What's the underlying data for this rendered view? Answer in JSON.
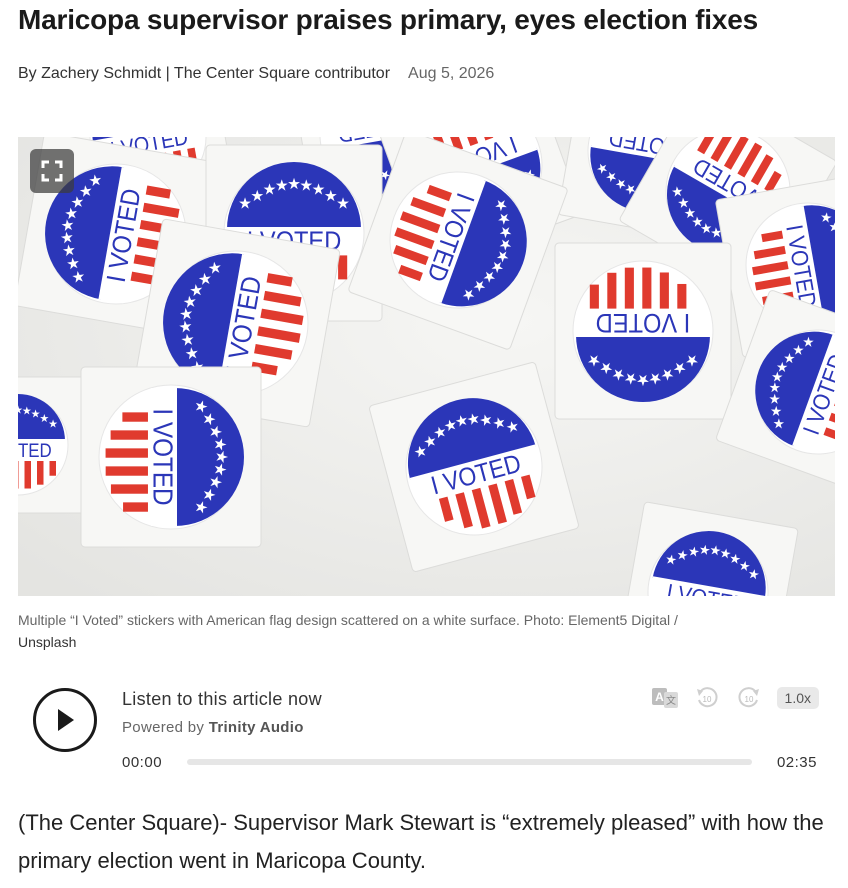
{
  "article": {
    "headline": "Maricopa supervisor praises primary, eyes election fixes",
    "byline": "By Zachery Schmidt | The Center Square contributor",
    "date": "Aug 5, 2026",
    "caption": "Multiple “I Voted” stickers with American flag design scattered on a white surface. Photo: Element5 Digital /",
    "caption_end": "Unsplash",
    "body": "(The Center Square)- Supervisor Mark Stewart is “extremely pleased” with how the primary election went in Maricopa County."
  },
  "hero": {
    "sticker_text": "I VOTED",
    "expand_icon": "expand-icon",
    "colors": {
      "blue": "#2b36b8",
      "red": "#e03a2e",
      "paper": "#f7f7f5",
      "backdrop": "#efefed"
    }
  },
  "player": {
    "title": "Listen to this article now",
    "powered_prefix": "Powered by",
    "powered_brand": "Trinity Audio",
    "time_start": "00:00",
    "time_end": "02:35",
    "speed": "1.0x",
    "progress": 0,
    "icons": [
      "play-icon",
      "translate-icon",
      "rewind-10-icon",
      "forward-10-icon"
    ]
  }
}
